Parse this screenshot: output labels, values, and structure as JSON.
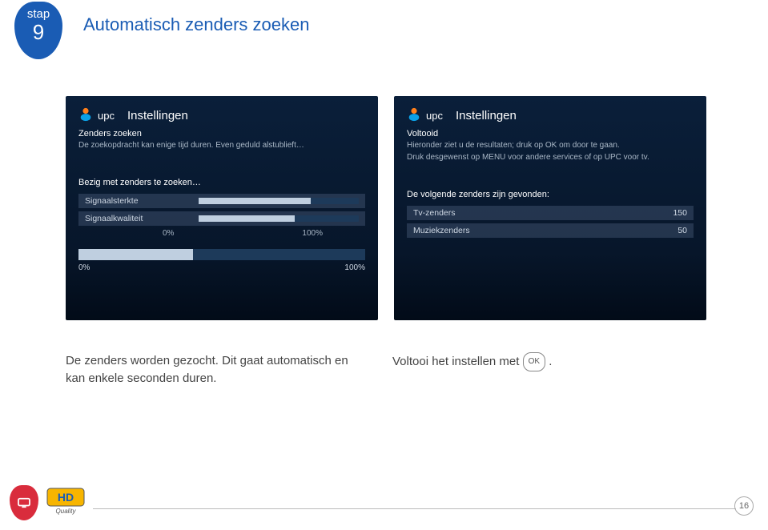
{
  "step": {
    "label": "stap",
    "number": "9"
  },
  "title": "Automatisch zenders zoeken",
  "tvLeft": {
    "brand": "upc",
    "section": "Instellingen",
    "sub1": "Zenders zoeken",
    "sub2": "De zoekopdracht kan enige tijd duren. Even geduld alstublieft…",
    "mid": "Bezig met zenders te zoeken…",
    "rows": [
      {
        "label": "Signaalsterkte",
        "pct": 70
      },
      {
        "label": "Signaalkwaliteit",
        "pct": 60
      }
    ],
    "scale0": "0%",
    "scale100": "100%",
    "mainPct": 40
  },
  "tvRight": {
    "brand": "upc",
    "section": "Instellingen",
    "sub1": "Voltooid",
    "sub2a": "Hieronder ziet u de resultaten; druk op OK om door te gaan.",
    "sub2b": "Druk desgewenst op MENU voor andere services of op UPC voor tv.",
    "mid": "De volgende zenders zijn gevonden:",
    "results": [
      {
        "label": "Tv-zenders",
        "value": "150"
      },
      {
        "label": "Muziekzenders",
        "value": "50"
      }
    ]
  },
  "captions": {
    "left": "De zenders worden gezocht. Dit gaat automatisch en kan enkele seconden duren.",
    "rightA": "Voltooi het instellen met ",
    "ok": "OK",
    "rightB": "."
  },
  "footer": {
    "hdTop": "HD",
    "hdBottom": "Quality",
    "page": "16"
  }
}
